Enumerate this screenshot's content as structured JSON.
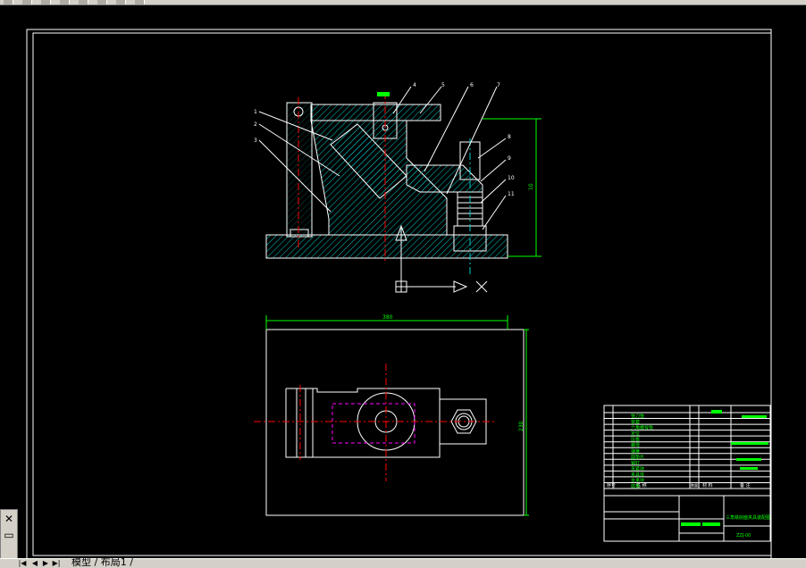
{
  "colors": {
    "background": "#000000",
    "drawing_line": "#ffffff",
    "hatch": "#00c8c8",
    "dimension": "#00ff00",
    "centerline": "#ff0000",
    "hidden_line": "#ff00ff",
    "leader": "#ffffff"
  },
  "icons": {
    "tool_x": "close-x-icon",
    "tool_window": "window-icon"
  },
  "statusbar": {
    "nav_first": "|◀",
    "nav_prev": "◀",
    "nav_next": "▶",
    "nav_last": "▶|",
    "layout_tabs": "模型 / 布局1 /"
  },
  "drawing": {
    "part_labels": [
      "1",
      "2",
      "3",
      "4",
      "5",
      "6",
      "7",
      "8",
      "9",
      "10",
      "11"
    ],
    "dim_height": "10",
    "dim_width": "380",
    "dim_depth": "230",
    "axis_x_label": "X",
    "title_block": {
      "row_items": [
        "铣刀铣",
        "铣套",
        "六角螺栓铣",
        "定位",
        "压板",
        "螺母",
        "弹簧",
        "圆垫片",
        "销钉",
        "夹紧块",
        "夹具体",
        "支承块",
        "底板"
      ],
      "header": [
        "序号",
        "名  称",
        "数量",
        "材  料",
        "备  注"
      ],
      "drawing_title": "三角铣削面夹具装配图",
      "drawing_number": "ZZJ-00"
    }
  }
}
